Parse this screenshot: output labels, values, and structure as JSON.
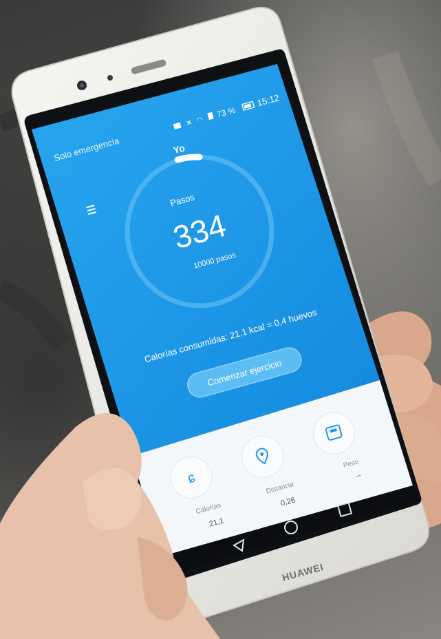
{
  "status_bar": {
    "carrier": "Solo emergencia",
    "battery": "73 %",
    "time": "15:12"
  },
  "header": {
    "title": "Yo"
  },
  "steps": {
    "label": "Pasos",
    "count": "334",
    "goal": "10000 pasos",
    "progress_fraction": 0.0334
  },
  "calories_summary": "Calorías consumidas: 21,1 kcal = 0,4 huevos",
  "start_button": "Comenzar ejercicio",
  "stats": [
    {
      "icon": "flame-icon",
      "label": "Calorías",
      "value": "21,1"
    },
    {
      "icon": "location-pin-icon",
      "label": "Distancia",
      "value": "0,26"
    },
    {
      "icon": "scale-icon",
      "label": "Peso",
      "value": "–"
    }
  ],
  "brand": "HUAWEI",
  "colors": {
    "app_blue": "#1e9be8",
    "phone_white": "#eeeeea",
    "bezel": "#111418"
  }
}
